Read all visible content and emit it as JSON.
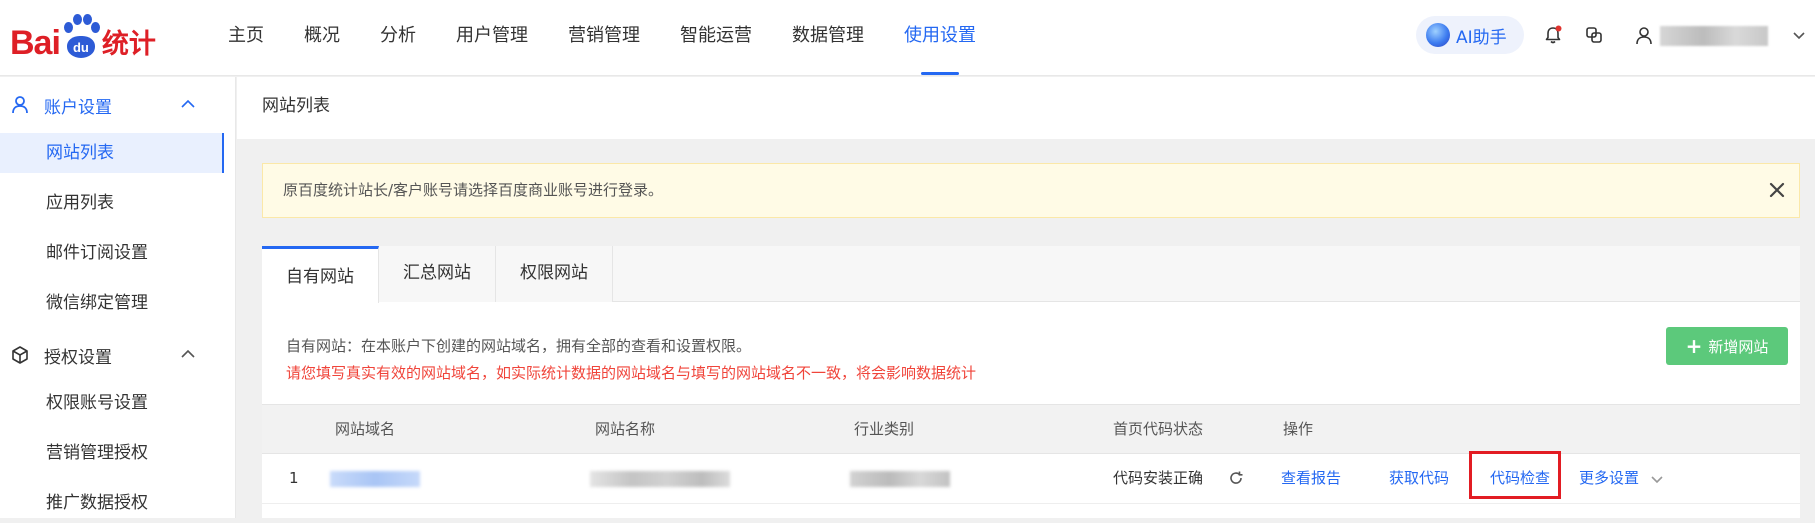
{
  "header": {
    "logo_bai": "Bai",
    "logo_du": "du",
    "logo_tongji": "统计",
    "nav": [
      "主页",
      "概况",
      "分析",
      "用户管理",
      "营销管理",
      "智能运营",
      "数据管理",
      "使用设置"
    ],
    "active_nav_index": 7,
    "ai_assistant": "AI助手",
    "username": "redacted username",
    "notification_dot_color": "#e0342f"
  },
  "sidebar": {
    "groups": [
      {
        "label": "账户设置",
        "icon": "user-icon",
        "expanded": true,
        "items": [
          "网站列表",
          "应用列表",
          "邮件订阅设置",
          "微信绑定管理"
        ]
      },
      {
        "label": "授权设置",
        "icon": "cube-icon",
        "expanded": true,
        "items": [
          "权限账号设置",
          "营销管理授权",
          "推广数据授权"
        ]
      }
    ],
    "active_item": "网站列表"
  },
  "breadcrumb": {
    "title": "网站列表"
  },
  "notice": {
    "text": "原百度统计站长/客户账号请选择百度商业账号进行登录。"
  },
  "tabs": {
    "items": [
      "自有网站",
      "汇总网站",
      "权限网站"
    ],
    "active_index": 0
  },
  "description": {
    "line1": "自有网站：在本账户下创建的网站域名，拥有全部的查看和设置权限。",
    "line2": "请您填写真实有效的网站域名，如实际统计数据的网站域名与填写的网站域名不一致，将会影响数据统计"
  },
  "add_site_button": "新增网站",
  "table": {
    "columns": [
      "网站域名",
      "网站名称",
      "行业类别",
      "首页代码状态",
      "操作"
    ],
    "rows": [
      {
        "index": "1",
        "domain": "(redacted)",
        "name": "(redacted)",
        "category": "(redacted)",
        "code_status": "代码安装正确",
        "actions": [
          "查看报告",
          "获取代码",
          "代码检查",
          "更多设置"
        ]
      }
    ],
    "highlighted_action": "代码检查"
  },
  "colors": {
    "accent": "#2468f2",
    "brand_red": "#de1f26",
    "warning_text": "#f0443a",
    "add_button": "#5cc97b",
    "highlight_box": "#e21c23"
  }
}
